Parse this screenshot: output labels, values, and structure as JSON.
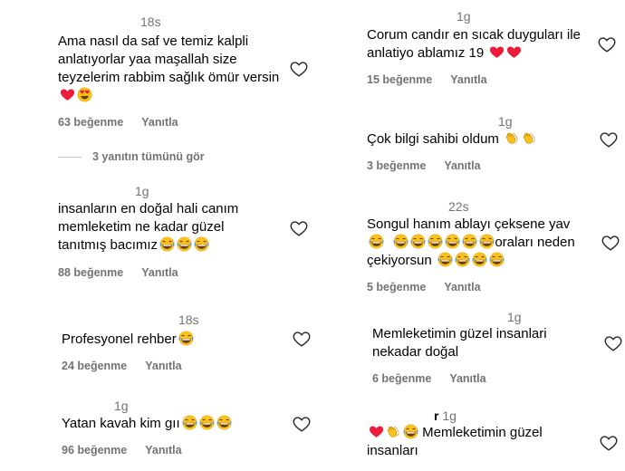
{
  "left": [
    {
      "time": "18s",
      "text": "Ama nasıl da saf ve temiz kalpli anlatıyorlar yaa maşallah size teyzelerim rabbim sağlık ömür versin",
      "likes": "63 beğenme",
      "reply": "Yanıtla",
      "emojis": [
        "heart",
        "heart-eyes"
      ]
    },
    {
      "time": "1g",
      "text": "insanların en doğal hali canım memleketim ne kadar güzel tanıtmış bacımız",
      "likes": "88 beğenme",
      "reply": "Yanıtla",
      "emojis": [
        "laugh",
        "laugh",
        "laugh"
      ]
    },
    {
      "time": "18s",
      "text": "Profesyonel rehber",
      "likes": "24 beğenme",
      "reply": "Yanıtla",
      "emojis": [
        "laugh"
      ]
    },
    {
      "time": "1g",
      "text": "Yatan kavah kim gıı",
      "likes": "96 beğenme",
      "reply": "Yanıtla",
      "emojis": [
        "laugh",
        "laugh",
        "laugh"
      ]
    }
  ],
  "view_replies": "3 yanıtın tümünü gör",
  "right": [
    {
      "time": "1g",
      "text": "Corum candır en sıcak duyguları ile anlatiyo ablamız 19",
      "likes": "15 beğenme",
      "reply": "Yanıtla",
      "emojis": [
        "heart",
        "heart"
      ]
    },
    {
      "time": "1g",
      "text": "Çok bilgi sahibi oldum",
      "likes": "3 beğenme",
      "reply": "Yanıtla",
      "emojis": [
        "clap",
        "clap"
      ]
    },
    {
      "time": "22s",
      "text_a": "Songul hanım ablayı çeksene yav",
      "text_b": "oraları neden",
      "text_c": "çekiyorsun",
      "likes": "5 beğenme",
      "reply": "Yanıtla"
    },
    {
      "time": "1g",
      "text": "Memleketimin güzel insanlari nekadar doğal",
      "likes": "6 beğenme",
      "reply": "Yanıtla"
    },
    {
      "prefix": "r",
      "time": "1g",
      "text_a": "Memleketimin güzel",
      "text_b": "insanları",
      "emojis": [
        "heart",
        "clap",
        "laugh"
      ]
    }
  ],
  "colors": {
    "heart": "#ed1c3c",
    "emoji_yellow": "#fcc21b",
    "meta": "#737373"
  }
}
